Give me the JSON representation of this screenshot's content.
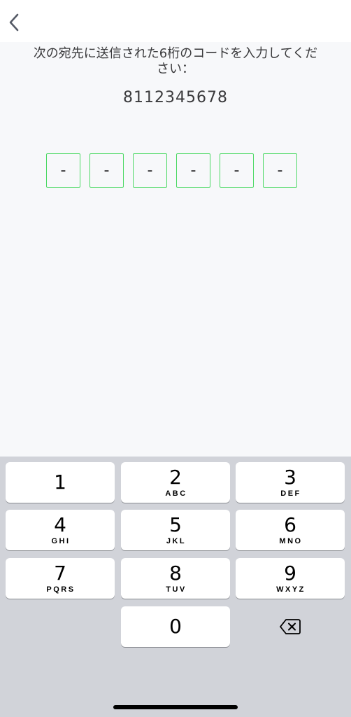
{
  "header": {
    "back_icon": "chevron-left-icon"
  },
  "verification": {
    "instruction": "次の宛先に送信された6桁のコードを入力してください：",
    "phone_number": "8112345678",
    "code_placeholders": [
      "-",
      "-",
      "-",
      "-",
      "-",
      "-"
    ],
    "box_border_color": "#4cd964"
  },
  "keypad": {
    "keys": [
      {
        "digit": "1",
        "letters": ""
      },
      {
        "digit": "2",
        "letters": "ABC"
      },
      {
        "digit": "3",
        "letters": "DEF"
      },
      {
        "digit": "4",
        "letters": "GHI"
      },
      {
        "digit": "5",
        "letters": "JKL"
      },
      {
        "digit": "6",
        "letters": "MNO"
      },
      {
        "digit": "7",
        "letters": "PQRS"
      },
      {
        "digit": "8",
        "letters": "TUV"
      },
      {
        "digit": "9",
        "letters": "WXYZ"
      }
    ],
    "zero": {
      "digit": "0"
    },
    "delete_icon": "backspace-icon"
  }
}
